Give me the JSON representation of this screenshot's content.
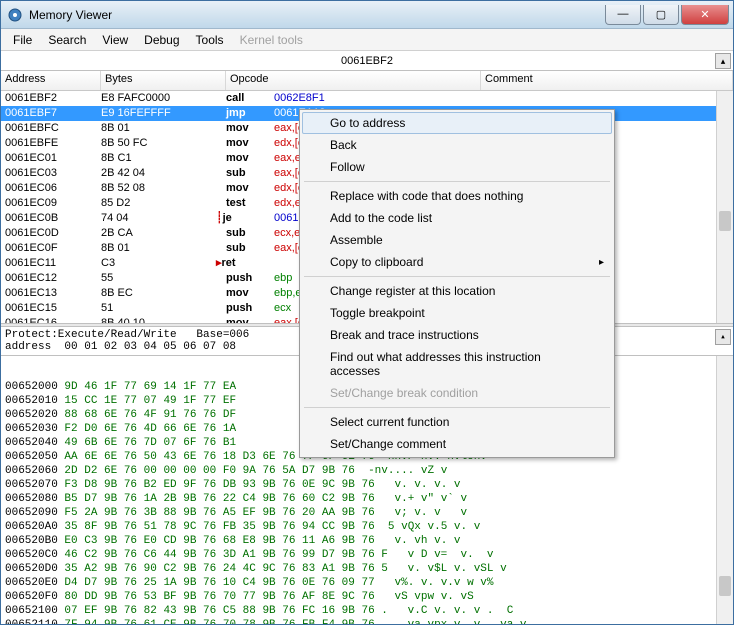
{
  "title": "Memory Viewer",
  "menu": [
    "File",
    "Search",
    "View",
    "Debug",
    "Tools",
    "Kernel tools"
  ],
  "current_address": "0061EBF2",
  "columns": {
    "addr": "Address",
    "bytes": "Bytes",
    "opcode": "Opcode",
    "comment": "Comment"
  },
  "disasm": [
    {
      "addr": "0061EBF2",
      "bytes": "E8 FAFC0000",
      "op": "call",
      "args": "0062E8F1",
      "cls": "blue"
    },
    {
      "addr": "0061EBF7",
      "bytes": "E9 16FEFFFF",
      "op": "jmp",
      "args": "0061EA12",
      "cls": "blue",
      "sel": true
    },
    {
      "addr": "0061EBFC",
      "bytes": "8B 01",
      "op": "mov",
      "args": "eax,[ecx]",
      "cls": "red"
    },
    {
      "addr": "0061EBFE",
      "bytes": "8B 50 FC",
      "op": "mov",
      "args": "edx,[eax-04]",
      "cls": "red"
    },
    {
      "addr": "0061EC01",
      "bytes": "8B C1",
      "op": "mov",
      "args": "eax,ecx",
      "cls": "red"
    },
    {
      "addr": "0061EC03",
      "bytes": "2B 42 04",
      "op": "sub",
      "args": "eax,[edx+04]",
      "cls": "red"
    },
    {
      "addr": "0061EC06",
      "bytes": "8B 52 08",
      "op": "mov",
      "args": "edx,[edx+08]",
      "cls": "red"
    },
    {
      "addr": "0061EC09",
      "bytes": "85 D2",
      "op": "test",
      "args": "edx,edx",
      "cls": "red"
    },
    {
      "addr": "0061EC0B",
      "bytes": "74 04",
      "op": "je",
      "args": "0061EC11",
      "cls": "blue",
      "jmp": true
    },
    {
      "addr": "0061EC0D",
      "bytes": "2B CA",
      "op": "sub",
      "args": "ecx,edx",
      "cls": "red"
    },
    {
      "addr": "0061EC0F",
      "bytes": "8B 01",
      "op": "sub",
      "args": "eax,[ecx]",
      "cls": "red"
    },
    {
      "addr": "0061EC11",
      "bytes": "C3",
      "op": "ret",
      "args": "",
      "cls": "",
      "arr": true
    },
    {
      "addr": "0061EC12",
      "bytes": "55",
      "op": "push",
      "args": "ebp",
      "cls": "green"
    },
    {
      "addr": "0061EC13",
      "bytes": "8B EC",
      "op": "mov",
      "args": "ebp,esp",
      "cls": "green"
    },
    {
      "addr": "0061EC15",
      "bytes": "51",
      "op": "push",
      "args": "ecx",
      "cls": "green"
    },
    {
      "addr": "0061EC16",
      "bytes": "8B 40 10",
      "op": "mov",
      "args": "eax,[eax+10]",
      "cls": "red"
    }
  ],
  "hex_header": "Protect:Execute/Read/Write   Base=006",
  "hex_cols": "address  00 01 02 03 04 05 06 07 08",
  "hex": [
    {
      "a": "00652000",
      "b": "9D 46 1F 77 69 14 1F 77 EA",
      "t": ""
    },
    {
      "a": "00652010",
      "b": "15 CC 1E 77 07 49 1F 77 EF",
      "t": ""
    },
    {
      "a": "00652020",
      "b": "88 68 6E 76 4F 91 76 76 DF",
      "t": ""
    },
    {
      "a": "00652030",
      "b": "F2 D0 6E 76 4D 66 6E 76 1A",
      "t": ""
    },
    {
      "a": "00652040",
      "b": "49 6B 6E 76 7D 07 6F 76 B1",
      "t": ""
    },
    {
      "a": "00652050",
      "b": "AA 6E 6E 76 50 43 6E 76 18 D3 6E 76 7F 6F 6E 76",
      "t": "nnvP nv. nvlonv"
    },
    {
      "a": "00652060",
      "b": "2D D2 6E 76 00 00 00 00 F0 9A 76 5A D7 9B 76",
      "t": "-nv.... vZ v"
    },
    {
      "a": "00652070",
      "b": "F3 D8 9B 76 B2 ED 9F 76 DB 93 9B 76 0E 9C 9B 76",
      "t": " v. v. v. v"
    },
    {
      "a": "00652080",
      "b": "B5 D7 9B 76 1A 2B 9B 76 22 C4 9B 76 60 C2 9B 76",
      "t": " v.+ v\" v` v"
    },
    {
      "a": "00652090",
      "b": "F5 2A 9B 76 3B 88 9B 76 A5 EF 9B 76 20 AA 9B 76",
      "t": " v; v. v   v"
    },
    {
      "a": "006520A0",
      "b": "35 8F 9B 76 51 78 9C 76 FB 35 9B 76 94 CC 9B 76",
      "t": "5 vQx v.5 v. v"
    },
    {
      "a": "006520B0",
      "b": "E0 C3 9B 76 E0 CD 9B 76 68 E8 9B 76 11 A6 9B 76",
      "t": " v. vh v. v"
    },
    {
      "a": "006520C0",
      "b": "46 C2 9B 76 C6 44 9B 76 3D A1 9B 76 99 D7 9B 76 F",
      "t": " v D v=  v.  v"
    },
    {
      "a": "006520D0",
      "b": "35 A2 9B 76 90 C2 9B 76 24 4C 9C 76 83 A1 9B 76 5",
      "t": " v. v$L v. vSL v"
    },
    {
      "a": "006520E0",
      "b": "D4 D7 9B 76 25 1A 9B 76 10 C4 9B 76 0E 76 09 77",
      "t": " v%. v. v.v w v%"
    },
    {
      "a": "006520F0",
      "b": "80 DD 9B 76 53 BF 9B 76 70 77 9B 76 AF 8E 9C 76",
      "t": " vS vpw v. vS"
    },
    {
      "a": "00652100",
      "b": "07 EF 9B 76 82 43 9B 76 C5 88 9B 76 FC 16 9B 76 .",
      "t": " v.C v. v. v .  C"
    },
    {
      "a": "00652110",
      "b": "7F 94 9B 76 61 CE 9B 76 70 78 9B 76 FB F4 9B 76 .",
      "t": " va vpx v. v . va.v"
    }
  ],
  "ctx": {
    "goto": "Go to address",
    "back": "Back",
    "follow": "Follow",
    "nop": "Replace with code that does nothing",
    "addlist": "Add to the code list",
    "assemble": "Assemble",
    "copy": "Copy to clipboard",
    "chreg": "Change register at this location",
    "togglebp": "Toggle breakpoint",
    "bt": "Break and trace instructions",
    "findacc": "Find out what addresses this instruction accesses",
    "setbc": "Set/Change break condition",
    "selfn": "Select current function",
    "setcom": "Set/Change comment"
  }
}
